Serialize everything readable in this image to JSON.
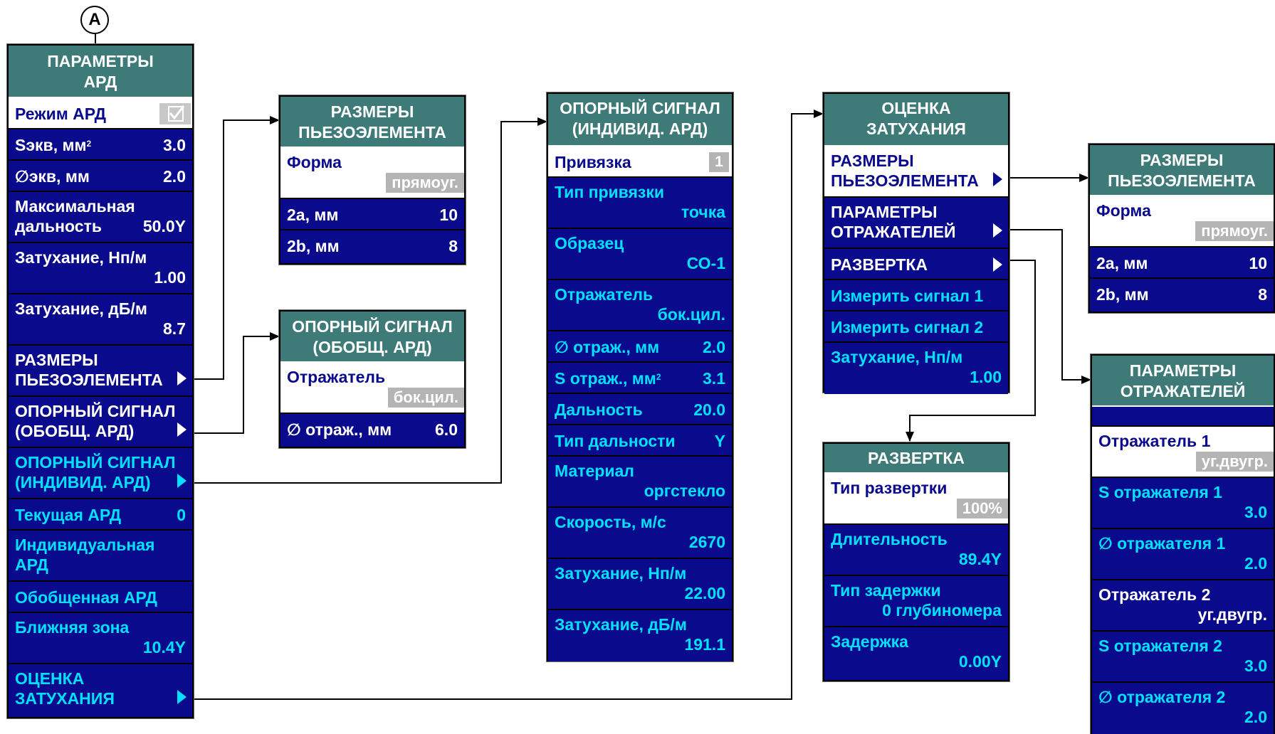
{
  "marker": "A",
  "main": {
    "title_l1": "ПАРАМЕТРЫ",
    "title_l2": "АРД",
    "mode_label": "Режим АРД",
    "s_label": "Sэкв, мм",
    "s_sup": "2",
    "s_value": "3.0",
    "d_label": "∅экв, мм",
    "d_value": "2.0",
    "maxrange_l1": "Максимальная",
    "maxrange_l2": "дальность",
    "maxrange_value": "50.0Y",
    "att_np_label": "Затухание, Нп/м",
    "att_np_value": "1.00",
    "att_db_label": "Затухание, дБ/м",
    "att_db_value": "8.7",
    "piezo_l1": "РАЗМЕРЫ",
    "piezo_l2": "ПЬЕЗОЭЛЕМЕНТА",
    "refgen_l1": "ОПОРНЫЙ СИГНАЛ",
    "refgen_l2": "(ОБОБЩ. АРД)",
    "refind_l1": "ОПОРНЫЙ СИГНАЛ",
    "refind_l2": "(ИНДИВИД. АРД)",
    "current_label": "Текущая АРД",
    "current_value": "0",
    "indiv_l1": "Индивидуальная",
    "indiv_l2": "АРД",
    "general_label": "Обобщенная АРД",
    "near_label": "Ближняя зона",
    "near_value": "10.4Y",
    "atten_l1": "ОЦЕНКА",
    "atten_l2": "ЗАТУХАНИЯ"
  },
  "piezo1": {
    "title_l1": "РАЗМЕРЫ",
    "title_l2": "ПЬЕЗОЭЛЕМЕНТА",
    "shape_label": "Форма",
    "shape_value": "прямоуг.",
    "a_label": "2a, мм",
    "a_value": "10",
    "b_label": "2b, мм",
    "b_value": "8"
  },
  "refgen": {
    "title_l1": "ОПОРНЫЙ СИГНАЛ",
    "title_l2": "(ОБОБЩ. АРД)",
    "refl_label": "Отражатель",
    "refl_value": "бок.цил.",
    "d_label": "∅ отраж., мм",
    "d_value": "6.0"
  },
  "refind": {
    "title_l1": "ОПОРНЫЙ СИГНАЛ",
    "title_l2": "(ИНДИВИД. АРД)",
    "bind_label": "Привязка",
    "bind_value": "1",
    "bindtype_label": "Тип привязки",
    "bindtype_value": "точка",
    "sample_label": "Образец",
    "sample_value": "СО-1",
    "refl_label": "Отражатель",
    "refl_value": "бок.цил.",
    "d_label": "∅ отраж., мм",
    "d_value": "2.0",
    "s_label": "S отраж., мм",
    "s_sup": "2",
    "s_value": "3.1",
    "range_label": "Дальность",
    "range_value": "20.0",
    "rangetype_label": "Тип дальности",
    "rangetype_value": "Y",
    "material_label": "Материал",
    "material_value": "оргстекло",
    "speed_label": "Скорость, м/с",
    "speed_value": "2670",
    "att_np_label": "Затухание, Нп/м",
    "att_np_value": "22.00",
    "att_db_label": "Затухание, дБ/м",
    "att_db_value": "191.1"
  },
  "atten": {
    "title_l1": "ОЦЕНКА",
    "title_l2": "ЗАТУХАНИЯ",
    "piezo_l1": "РАЗМЕРЫ",
    "piezo_l2": "ПЬЕЗОЭЛЕМЕНТА",
    "refl_l1": "ПАРАМЕТРЫ",
    "refl_l2": "ОТРАЖАТЕЛЕЙ",
    "sweep_label": "РАЗВЕРТКА",
    "meas1_label": "Измерить сигнал 1",
    "meas2_label": "Измерить сигнал 2",
    "att_label": "Затухание, Нп/м",
    "att_value": "1.00"
  },
  "sweep": {
    "title": "РАЗВЕРТКА",
    "type_label": "Тип развертки",
    "type_value": "100%",
    "dur_label": "Длительность",
    "dur_value": "89.4Y",
    "delaytype_label": "Тип задержки",
    "delaytype_value": "0 глубиномера",
    "delay_label": "Задержка",
    "delay_value": "0.00Y"
  },
  "piezo2": {
    "title_l1": "РАЗМЕРЫ",
    "title_l2": "ПЬЕЗОЭЛЕМЕНТА",
    "shape_label": "Форма",
    "shape_value": "прямоуг.",
    "a_label": "2a, мм",
    "a_value": "10",
    "b_label": "2b, мм",
    "b_value": "8"
  },
  "reflpar": {
    "title_l1": "ПАРАМЕТРЫ",
    "title_l2": "ОТРАЖАТЕЛЕЙ",
    "r1_label": "Отражатель 1",
    "r1_value": "уг.двугр.",
    "s1_label": "S отражателя 1",
    "s1_value": "3.0",
    "d1_label": "∅ отражателя 1",
    "d1_value": "2.0",
    "r2_label": "Отражатель 2",
    "r2_value": "уг.двугр.",
    "s2_label": "S отражателя 2",
    "s2_value": "3.0",
    "d2_label": "∅ отражателя 2",
    "d2_value": "2.0"
  },
  "colors": {
    "panel": "#0a0a8c",
    "header": "#3d7a78",
    "cyan": "#00e0ff",
    "chip": "#b4b4b4"
  }
}
